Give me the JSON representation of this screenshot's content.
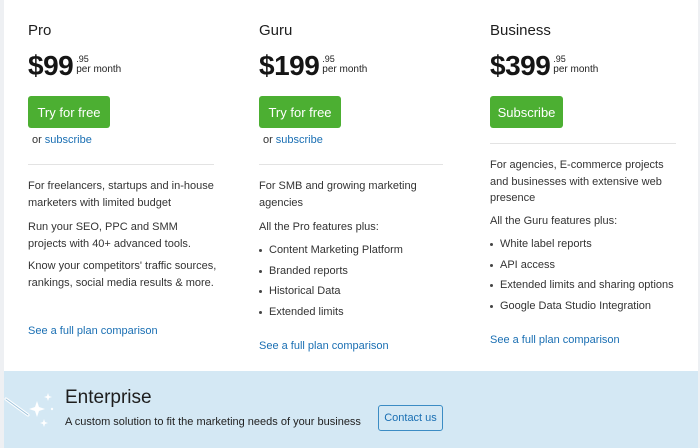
{
  "plans": [
    {
      "name": "Pro",
      "price_main": "$99",
      "price_cents": ".95",
      "price_period": "per month",
      "cta_label": "Try for free",
      "or_text": "or",
      "subscribe_link": "subscribe",
      "description": "For freelancers, startups and in-house marketers with limited budget",
      "extra_paragraphs": [
        "Run your SEO, PPC and SMM projects with 40+ advanced tools.",
        "Know your competitors' traffic sources, rankings, social media results & more."
      ],
      "compare_link": "See a full plan comparison"
    },
    {
      "name": "Guru",
      "price_main": "$199",
      "price_cents": ".95",
      "price_period": "per month",
      "cta_label": "Try for free",
      "or_text": "or",
      "subscribe_link": "subscribe",
      "description": "For SMB and growing marketing agencies",
      "features_intro": "All the Pro features plus:",
      "features": [
        "Content Marketing Platform",
        "Branded reports",
        "Historical Data",
        "Extended limits"
      ],
      "compare_link": "See a full plan comparison"
    },
    {
      "name": "Business",
      "price_main": "$399",
      "price_cents": ".95",
      "price_period": "per month",
      "cta_label": "Subscribe",
      "description": "For agencies, E-commerce projects and businesses with extensive web presence",
      "features_intro": "All the Guru features plus:",
      "features": [
        "White label reports",
        "API access",
        "Extended limits and sharing options",
        "Google Data Studio Integration"
      ],
      "compare_link": "See a full plan comparison"
    }
  ],
  "enterprise": {
    "title": "Enterprise",
    "subtitle": "A custom solution to fit the marketing needs of your business",
    "contact_label": "Contact us",
    "icon": "magic-wand-icon"
  },
  "colors": {
    "cta_green": "#4caf32",
    "link_blue": "#1a6fb3",
    "enterprise_bg": "#d4e8f4"
  }
}
